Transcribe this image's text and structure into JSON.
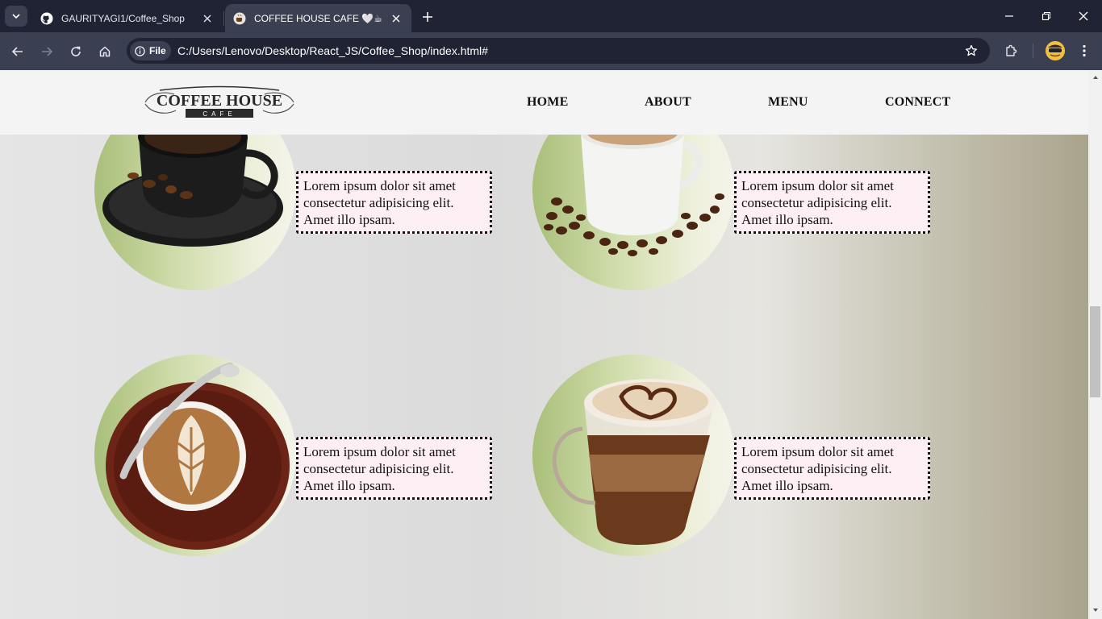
{
  "browser": {
    "tabs": [
      {
        "title": "GAURITYAGI1/Coffee_Shop",
        "icon": "github-icon",
        "active": false
      },
      {
        "title": "COFFEE HOUSE CAFE 🤍☕",
        "icon": "coffee-favicon-icon",
        "active": true
      }
    ],
    "address": {
      "security_label": "File",
      "url": "C:/Users/Lenovo/Desktop/React_JS/Coffee_Shop/index.html#"
    }
  },
  "site": {
    "logo": {
      "line1": "COFFEE HOUSE",
      "line2": "CAFE"
    },
    "nav": [
      "HOME",
      "ABOUT",
      "MENU",
      "CONNECT"
    ]
  },
  "menu_items": [
    {
      "image": "black-coffee-cup-image",
      "text": "Lorem ipsum dolor sit amet consectetur adipisicing elit. Amet illo ipsam."
    },
    {
      "image": "white-cup-coffee-beans-image",
      "text": "Lorem ipsum dolor sit amet consectetur adipisicing elit. Amet illo ipsam."
    },
    {
      "image": "latte-art-cup-image",
      "text": "Lorem ipsum dolor sit amet consectetur adipisicing elit. Amet illo ipsam."
    },
    {
      "image": "cappuccino-glass-image",
      "text": "Lorem ipsum dolor sit amet consectetur adipisicing elit. Amet illo ipsam."
    }
  ],
  "colors": {
    "chrome_dark": "#1f2333",
    "chrome_light": "#3a3f52",
    "header_bg": "#f4f4f4",
    "desc_bg": "#fdeff4",
    "circle_green": "#a9bf7a"
  }
}
